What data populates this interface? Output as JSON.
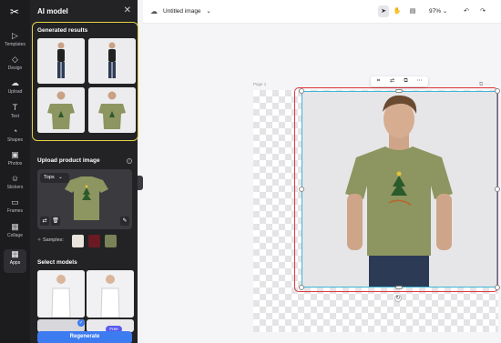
{
  "rail": {
    "items": [
      {
        "label": "Templates",
        "icon": "template-icon",
        "glyph": "▷"
      },
      {
        "label": "Design",
        "icon": "design-icon",
        "glyph": "◇"
      },
      {
        "label": "Upload",
        "icon": "upload-icon",
        "glyph": "☁"
      },
      {
        "label": "Text",
        "icon": "text-icon",
        "glyph": "T"
      },
      {
        "label": "Shapes",
        "icon": "shapes-icon",
        "glyph": "◔"
      },
      {
        "label": "Photos",
        "icon": "photos-icon",
        "glyph": "▣"
      },
      {
        "label": "Stickers",
        "icon": "stickers-icon",
        "glyph": "☺"
      },
      {
        "label": "Frames",
        "icon": "frames-icon",
        "glyph": "▭"
      },
      {
        "label": "Collage",
        "icon": "collage-icon",
        "glyph": "▦"
      },
      {
        "label": "Apps",
        "icon": "apps-icon",
        "glyph": "▦"
      }
    ]
  },
  "panel": {
    "title": "AI model",
    "generated_label": "Generated results",
    "upload_label": "Upload product image",
    "category_select": "Tops",
    "samples_label": "Samples:",
    "models_label": "Select models",
    "regenerate_label": "Regenerate",
    "free_badge": "Free"
  },
  "topbar": {
    "doc_title": "Untitled image",
    "zoom": "97%"
  },
  "canvas": {
    "page_label": "Page 1"
  },
  "colors": {
    "accent_yellow": "#e3d341",
    "selection_red": "#e0353a",
    "selection_blue": "#3fb4d8",
    "button_blue": "#3d7bf0",
    "shirt_olive": "#8d9560"
  }
}
